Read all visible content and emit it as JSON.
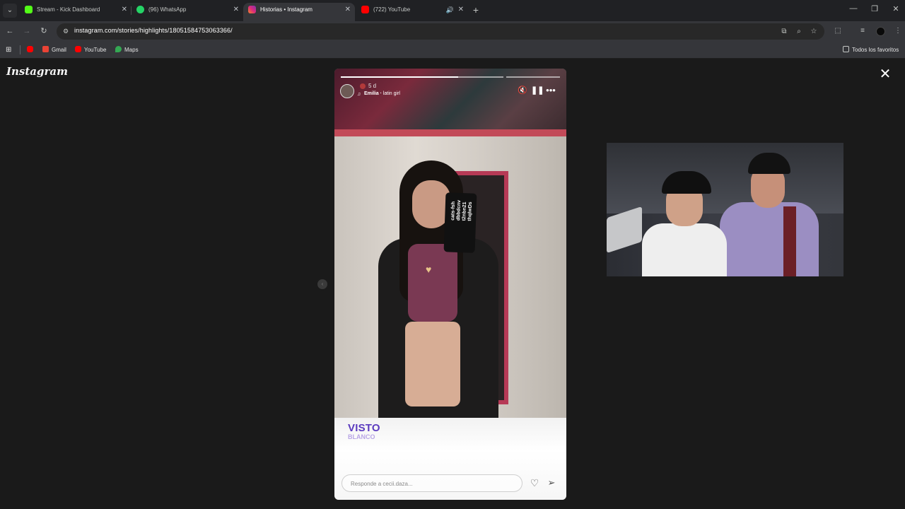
{
  "browser": {
    "tabs": [
      {
        "label": "Stream - Kick Dashboard",
        "favicon_color": "#53fc18",
        "active": false
      },
      {
        "label": "(96) WhatsApp",
        "favicon_color": "#25d366",
        "active": false
      },
      {
        "label": "Historias • Instagram",
        "favicon_color": "#e1306c",
        "active": true
      },
      {
        "label": "(722) YouTube",
        "favicon_color": "#ff0000",
        "active": false
      }
    ],
    "url": "instagram.com/stories/highlights/18051584753063366/",
    "bookmarks": [
      {
        "label": "Gmail",
        "icon": "gmail-icon",
        "color": "#ea4335"
      },
      {
        "label": "YouTube",
        "icon": "youtube-icon",
        "color": "#ff0000"
      },
      {
        "label": "Maps",
        "icon": "maps-icon",
        "color": "#34a853"
      }
    ],
    "all_bookmarks_label": "Todos los favoritos"
  },
  "page": {
    "logo": "Instagram"
  },
  "story": {
    "time_ago": "5 d",
    "music_artist": "Emilia",
    "music_title": "latin girl",
    "phone_caption": "cats-fsh\ndbbdcnv\nt2nbn21\nthqlwDs",
    "overlay_title": "VISTO",
    "overlay_subtitle": "BLANCO",
    "reply_placeholder": "Responde a cecii.daza...",
    "progress_fraction": 0.72
  }
}
